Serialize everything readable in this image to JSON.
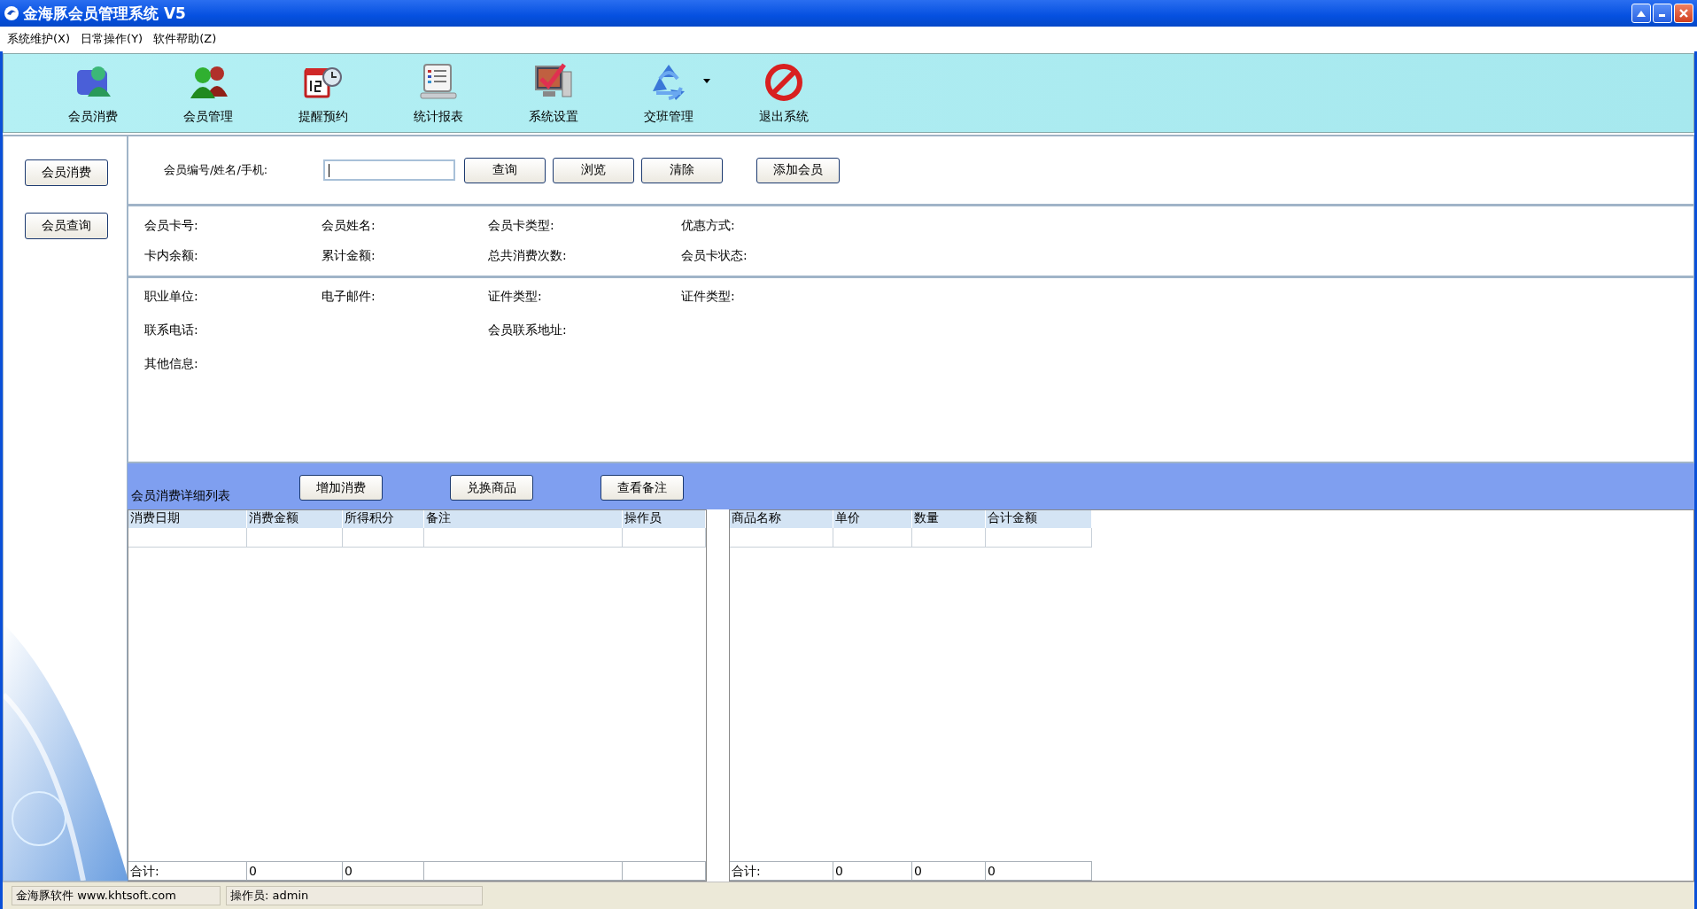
{
  "window": {
    "title": "金海豚会员管理系统 V5"
  },
  "menu": [
    "系统维护(X)",
    "日常操作(Y)",
    "软件帮助(Z)"
  ],
  "toolbar": [
    {
      "label": "会员消费",
      "dropdown": false
    },
    {
      "label": "会员管理",
      "dropdown": false
    },
    {
      "label": "提醒预约",
      "dropdown": false
    },
    {
      "label": "统计报表",
      "dropdown": false
    },
    {
      "label": "系统设置",
      "dropdown": false
    },
    {
      "label": "交班管理",
      "dropdown": true
    },
    {
      "label": "退出系统",
      "dropdown": false
    }
  ],
  "sidebar": {
    "buttons": [
      "会员消费",
      "会员查询"
    ]
  },
  "search": {
    "label": "会员编号/姓名/手机:",
    "focused": true,
    "buttons": [
      "查询",
      "浏览",
      "清除"
    ],
    "add_button": "添加会员"
  },
  "card_info": [
    [
      "会员卡号:",
      "会员姓名:",
      "会员卡类型:",
      "优惠方式:"
    ],
    [
      "卡内余额:",
      "累计金额:",
      "总共消费次数:",
      "会员卡状态:"
    ]
  ],
  "member_info": [
    {
      "col_1": "职业单位:",
      "col_2": "电子邮件:",
      "col_3": "证件类型:",
      "col_4": "证件类型:"
    },
    {
      "col_1": "联系电话:",
      "col_3": "会员联系地址:"
    },
    {
      "col_1": "其他信息:"
    }
  ],
  "detail_bar": {
    "title": "会员消费详细列表",
    "buttons": [
      "增加消费",
      "兑换商品",
      "查看备注"
    ]
  },
  "consumption_table": {
    "columns": [
      "消费日期",
      "消费金额",
      "所得积分",
      "备注",
      "操作员"
    ],
    "totals": [
      "合计:",
      "0",
      "0"
    ]
  },
  "goods_table": {
    "columns": [
      "商品名称",
      "单价",
      "数量",
      "合计金额"
    ],
    "totals": [
      "合计:",
      "0",
      "0",
      "0"
    ]
  },
  "status_bar": [
    "金海豚软件 www.khtsoft.com",
    "操作员: admin"
  ]
}
